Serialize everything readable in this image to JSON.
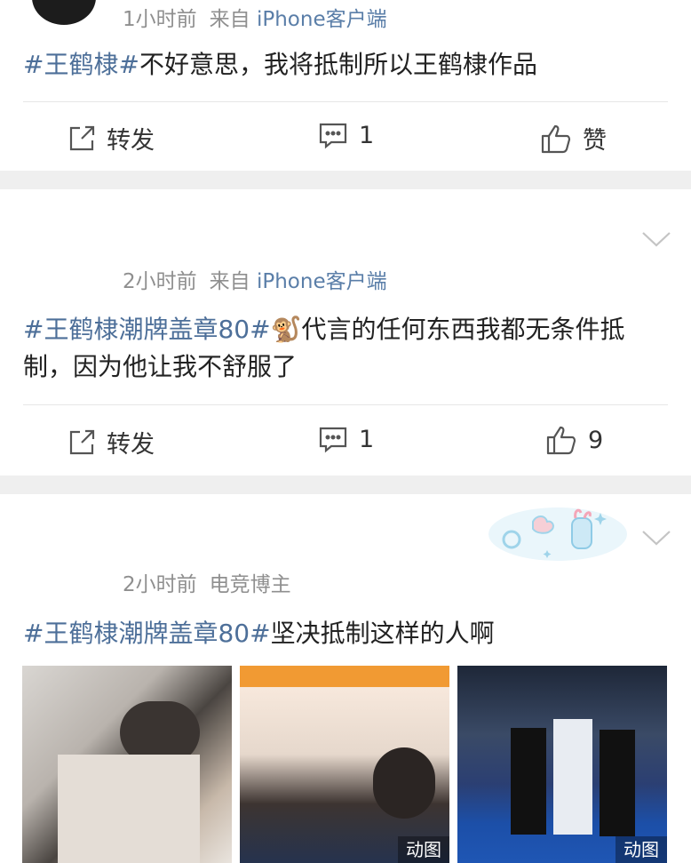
{
  "posts": [
    {
      "time": "1小时前",
      "source_prefix": "来自",
      "client": "iPhone客户端",
      "topic": "#王鹤棣#",
      "text": "不好意思，我将抵制所以王鹤棣作品",
      "actions": {
        "repost": "转发",
        "comment": "1",
        "like": "赞"
      }
    },
    {
      "time": "2小时前",
      "source_prefix": "来自",
      "client": "iPhone客户端",
      "topic": "#王鹤棣潮牌盖章80#",
      "emoji": "🐒",
      "text": "代言的任何东西我都无条件抵制，因为他让我不舒服了",
      "actions": {
        "repost": "转发",
        "comment": "1",
        "like": "9"
      }
    },
    {
      "time": "2小时前",
      "author_tag": "电竞博主",
      "topic": "#王鹤棣潮牌盖章80#",
      "text": "坚决抵制这样的人啊",
      "images": [
        {
          "icon": "video-still-image",
          "badge": ""
        },
        {
          "icon": "video-still-image",
          "badge": "动图"
        },
        {
          "icon": "video-still-image",
          "badge": "动图"
        }
      ]
    }
  ]
}
